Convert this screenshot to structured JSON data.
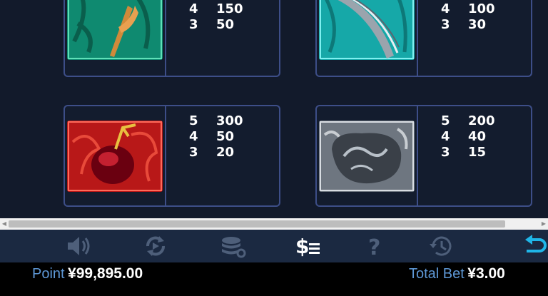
{
  "paytable": {
    "symbols": [
      {
        "name": "dragon-staff",
        "pays": [
          {
            "count": "4",
            "value": "150"
          },
          {
            "count": "3",
            "value": "50"
          }
        ]
      },
      {
        "name": "jade-feather",
        "pays": [
          {
            "count": "4",
            "value": "100"
          },
          {
            "count": "3",
            "value": "30"
          }
        ]
      },
      {
        "name": "phoenix-egg",
        "pays": [
          {
            "count": "5",
            "value": "300"
          },
          {
            "count": "4",
            "value": "50"
          },
          {
            "count": "3",
            "value": "20"
          }
        ]
      },
      {
        "name": "silver-jade-stone",
        "pays": [
          {
            "count": "5",
            "value": "200"
          },
          {
            "count": "4",
            "value": "40"
          },
          {
            "count": "3",
            "value": "15"
          }
        ]
      }
    ]
  },
  "toolbar": {
    "buttons": [
      "sound-icon",
      "autoplay-icon",
      "chips-settings-icon",
      "paytable-icon",
      "help-icon",
      "history-icon",
      "back-icon"
    ],
    "colors": {
      "muted": "#4e5f7a",
      "active": "#ffffff",
      "accent": "#1fb6e8"
    }
  },
  "status": {
    "point_label": "Point",
    "point_value": "¥99,895.00",
    "bet_label": "Total Bet",
    "bet_value": "¥3.00"
  }
}
